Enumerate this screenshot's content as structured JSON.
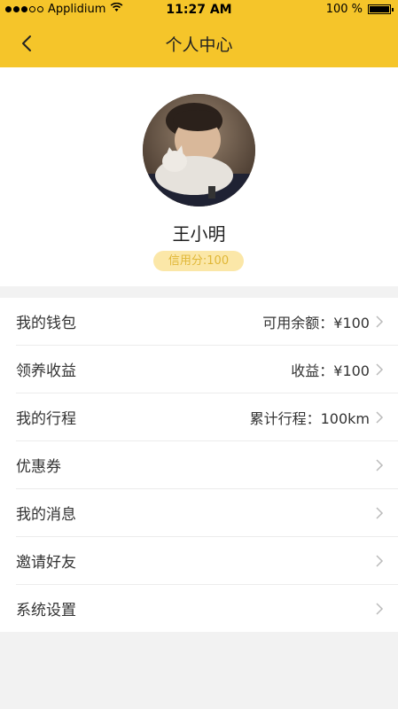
{
  "status": {
    "carrier": "Applidium",
    "time": "11:27 AM",
    "battery": "100 %"
  },
  "nav": {
    "title": "个人中心"
  },
  "profile": {
    "name": "王小明",
    "credit": "信用分:100"
  },
  "menu": [
    {
      "label": "我的钱包",
      "value": "可用余额：¥100"
    },
    {
      "label": "领养收益",
      "value": "收益：¥100"
    },
    {
      "label": "我的行程",
      "value": "累计行程：100km"
    },
    {
      "label": "优惠券",
      "value": ""
    },
    {
      "label": "我的消息",
      "value": ""
    },
    {
      "label": "邀请好友",
      "value": ""
    },
    {
      "label": "系统设置",
      "value": ""
    }
  ],
  "colors": {
    "accent": "#f5c52a",
    "credit_bg": "#fbe7a8",
    "credit_text": "#e0b737"
  }
}
